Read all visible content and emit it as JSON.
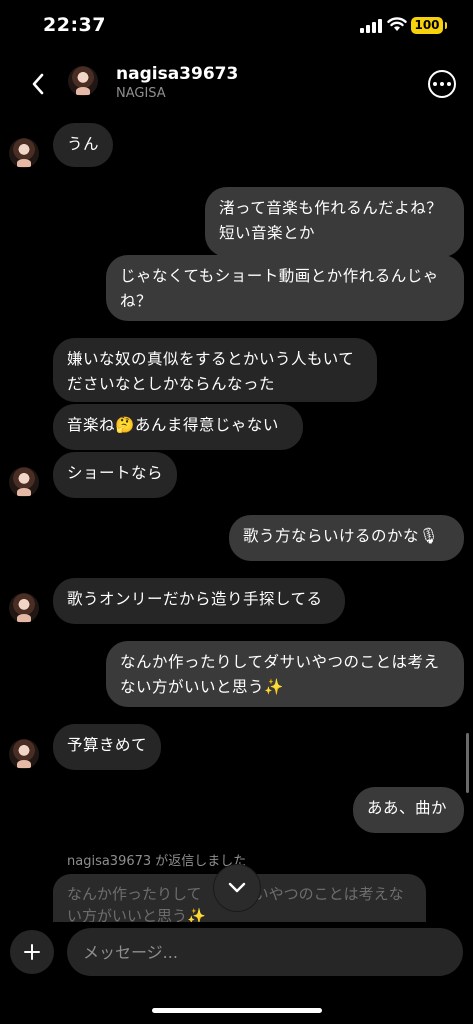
{
  "status": {
    "time": "22:37",
    "battery": "100"
  },
  "header": {
    "username": "nagisa39673",
    "display_name": "NAGISA"
  },
  "messages": {
    "m1": "うん",
    "m2_l1": "渚って音楽も作れるんだよね？",
    "m2_l2": "短い音楽とか",
    "m3_l1": "じゃなくてもショート動画とか作れるんじゃ",
    "m3_l2": "ね？",
    "m4_l1": "嫌いな奴の真似をするとかいう人もいて",
    "m4_l2": "ださいなとしかならんなった",
    "m5_a": "音楽ね",
    "m5_b": "あんま得意じゃない",
    "m6": "ショートなら",
    "m7": "歌う方ならいけるのかな",
    "m8": "歌うオンリーだから造り手探してる",
    "m9_l1": "なんか作ったりしてダサいやつのことは考え",
    "m9_l2": "ない方がいいと思う",
    "m10": "予算きめて",
    "m11": "ああ、曲か"
  },
  "emoji": {
    "thinking": "🤔",
    "mic": "🎙",
    "sparkles": "✨"
  },
  "reply": {
    "label": "nagisa39673 が返信しました",
    "preview_l1": "なんか作ったりして",
    "preview_l1b": "いやつのことは考えな",
    "preview_l2": "い方がいいと思う"
  },
  "composer": {
    "placeholder": "メッセージ..."
  }
}
